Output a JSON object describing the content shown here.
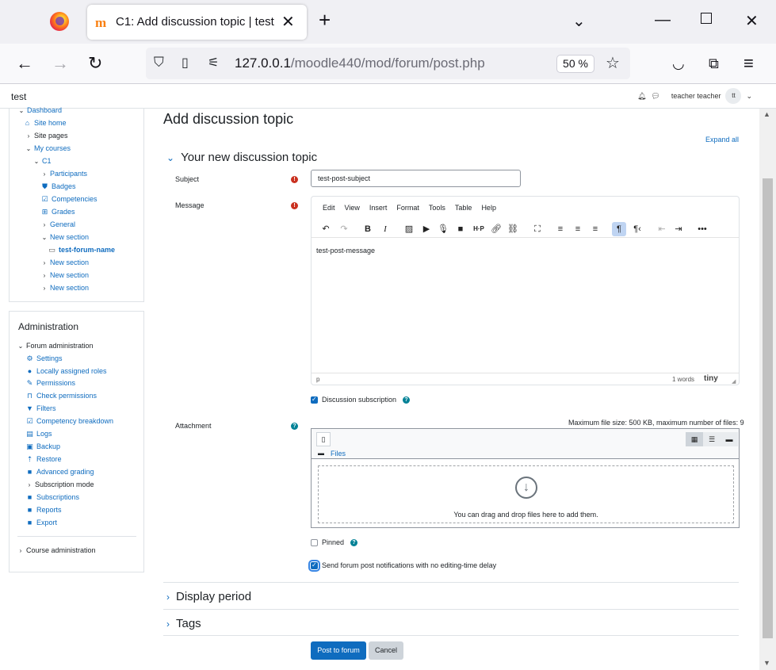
{
  "browser": {
    "tab_title": "C1: Add discussion topic | test",
    "favicon": "m",
    "url_host": "127.0.0.1",
    "url_path": "/moodle440/mod/forum/post.php",
    "zoom": "50 %"
  },
  "header": {
    "site_name": "test",
    "user_name": "teacher teacher",
    "avatar_initials": "tt"
  },
  "nav": {
    "items": [
      {
        "label": "Dashboard",
        "icon": "chevron-down-icon"
      },
      {
        "label": "Site home",
        "icon": "home-icon"
      },
      {
        "label": "Site pages",
        "icon": "chevron-right-icon"
      },
      {
        "label": "My courses",
        "icon": "chevron-down-icon"
      },
      {
        "label": "C1",
        "icon": "chevron-down-icon"
      },
      {
        "label": "Participants",
        "icon": "chevron-right-icon"
      },
      {
        "label": "Badges",
        "icon": "badge-icon"
      },
      {
        "label": "Competencies",
        "icon": "competency-icon"
      },
      {
        "label": "Grades",
        "icon": "table-icon"
      },
      {
        "label": "General",
        "icon": "chevron-right-icon"
      },
      {
        "label": "New section",
        "icon": "chevron-down-icon"
      },
      {
        "label": "test-forum-name",
        "icon": "forum-icon"
      },
      {
        "label": "New section",
        "icon": "chevron-right-icon"
      },
      {
        "label": "New section",
        "icon": "chevron-right-icon"
      },
      {
        "label": "New section",
        "icon": "chevron-right-icon"
      }
    ]
  },
  "admin": {
    "title": "Administration",
    "forum_admin": "Forum administration",
    "items": [
      {
        "label": "Settings",
        "icon": "gear-icon"
      },
      {
        "label": "Locally assigned roles",
        "icon": "user-icon"
      },
      {
        "label": "Permissions",
        "icon": "edit-icon"
      },
      {
        "label": "Check permissions",
        "icon": "unlock-icon"
      },
      {
        "label": "Filters",
        "icon": "filter-icon"
      },
      {
        "label": "Competency breakdown",
        "icon": "check-square-icon"
      },
      {
        "label": "Logs",
        "icon": "logs-icon"
      },
      {
        "label": "Backup",
        "icon": "backup-icon"
      },
      {
        "label": "Restore",
        "icon": "restore-icon"
      },
      {
        "label": "Advanced grading",
        "icon": "square-icon"
      },
      {
        "label": "Subscription mode",
        "icon": "chevron-right-icon"
      },
      {
        "label": "Subscriptions",
        "icon": "square-icon"
      },
      {
        "label": "Reports",
        "icon": "square-icon"
      },
      {
        "label": "Export",
        "icon": "square-icon"
      }
    ],
    "course_admin": "Course administration"
  },
  "main": {
    "page_title": "Add discussion topic",
    "expand_all": "Expand all",
    "section_new": "Your new discussion topic",
    "subject_label": "Subject",
    "subject_value": "test-post-subject",
    "message_label": "Message",
    "editor_menu": [
      "Edit",
      "View",
      "Insert",
      "Format",
      "Tools",
      "Table",
      "Help"
    ],
    "message_value": "test-post-message",
    "editor_path": "p",
    "word_count": "1 words",
    "tiny_logo": "tiny",
    "discussion_subscription": "Discussion subscription",
    "attachment_label": "Attachment",
    "max_file_size": "Maximum file size: 500 KB, maximum number of files: 9",
    "files_folder": "Files",
    "dropzone_text": "You can drag and drop files here to add them.",
    "pinned_label": "Pinned",
    "notify_label": "Send forum post notifications with no editing-time delay",
    "section_display": "Display period",
    "section_tags": "Tags",
    "submit_label": "Post to forum",
    "cancel_label": "Cancel"
  }
}
